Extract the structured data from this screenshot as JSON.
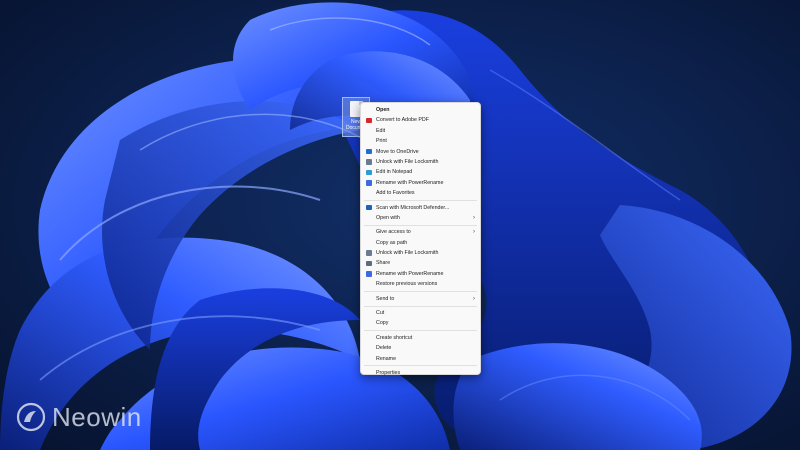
{
  "colors": {
    "background": "#0a1a3a",
    "ribbon_primary": "#2a56ff",
    "ribbon_light": "#6d8eff",
    "menu_bg": "#f9f9f9"
  },
  "desktop_icon": {
    "label": "New\nDocum..."
  },
  "context_menu": {
    "groups": [
      [
        {
          "label": "Open",
          "bold": true
        },
        {
          "label": "Convert to Adobe PDF",
          "icon": "adobe-pdf-icon"
        },
        {
          "label": "Edit"
        },
        {
          "label": "Print"
        },
        {
          "label": "Move to OneDrive",
          "icon": "onedrive-icon"
        },
        {
          "label": "Unlock with File Locksmith",
          "icon": "lock-icon"
        },
        {
          "label": "Edit in Notepad",
          "icon": "notepad-icon"
        },
        {
          "label": "Rename with PowerRename",
          "icon": "powerrename-icon"
        },
        {
          "label": "Add to Favorites"
        }
      ],
      [
        {
          "label": "Scan with Microsoft Defender...",
          "icon": "defender-shield-icon"
        },
        {
          "label": "Open with",
          "submenu": true
        }
      ],
      [
        {
          "label": "Give access to",
          "submenu": true
        },
        {
          "label": "Copy as path"
        },
        {
          "label": "Unlock with File Locksmith",
          "icon": "lock-icon"
        },
        {
          "label": "Share",
          "icon": "share-icon"
        },
        {
          "label": "Rename with PowerRename",
          "icon": "powerrename-icon"
        },
        {
          "label": "Restore previous versions"
        }
      ],
      [
        {
          "label": "Send to",
          "submenu": true
        }
      ],
      [
        {
          "label": "Cut"
        },
        {
          "label": "Copy"
        }
      ],
      [
        {
          "label": "Create shortcut"
        },
        {
          "label": "Delete"
        },
        {
          "label": "Rename"
        }
      ],
      [
        {
          "label": "Properties"
        }
      ]
    ]
  },
  "watermark": {
    "text": "Neowin",
    "icon": "neowin-logo-icon"
  }
}
